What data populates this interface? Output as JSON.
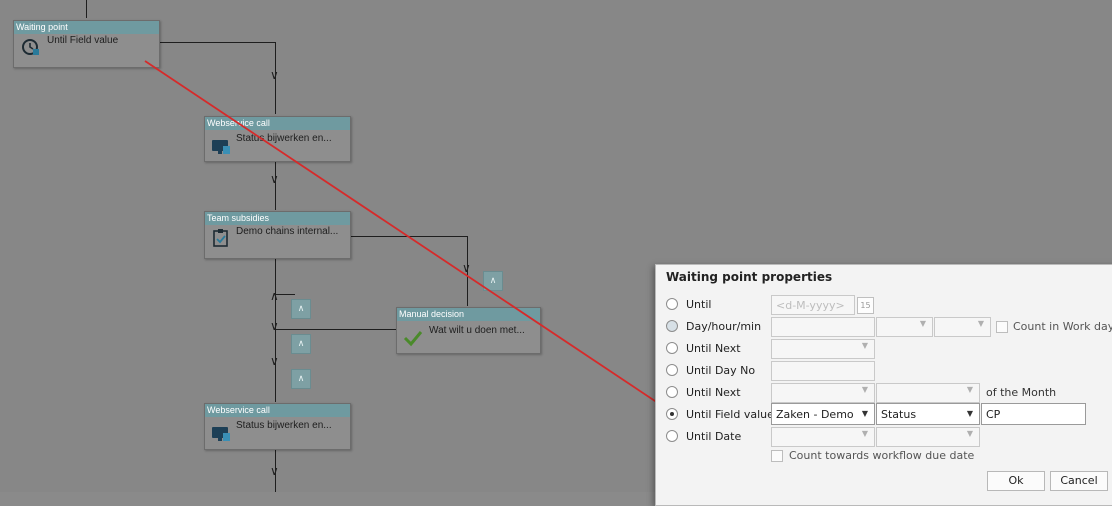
{
  "workflow": {
    "nodes": [
      {
        "title": "Waiting point",
        "text": "Until Field value",
        "icon": "waiting-clock-icon"
      },
      {
        "title": "Webservice call",
        "text": "Status bijwerken en...",
        "icon": "webservice-monitor-icon"
      },
      {
        "title": "Team subsidies",
        "text": "Demo chains internal...",
        "icon": "task-clipboard-icon"
      },
      {
        "title": "Manual decision",
        "text": "Wat wilt u doen met...",
        "icon": "checkmark-icon"
      },
      {
        "title": "Webservice call",
        "text": "Status bijwerken en...",
        "icon": "webservice-monitor-icon"
      }
    ],
    "annotation_color": "#d62a2a"
  },
  "dialog": {
    "title": "Waiting point properties",
    "rows": [
      {
        "label": "Until",
        "checked": false
      },
      {
        "label": "Day/hour/min",
        "checked": false
      },
      {
        "label": "Until Next",
        "checked": false
      },
      {
        "label": "Until Day No",
        "checked": false
      },
      {
        "label": "Until Next",
        "checked": false
      },
      {
        "label": "Until Field value",
        "checked": true
      },
      {
        "label": "Until Date",
        "checked": false
      }
    ],
    "date_placeholder": "<d-M-yyyy>",
    "calendar_day": "15",
    "count_in_work_days": "Count in Work days",
    "of_the_month": "of the Month",
    "field_value": {
      "entity": "Zaken - Demo",
      "field": "Status",
      "value": "CP"
    },
    "count_towards_due_date": "Count towards workflow due date",
    "ok_label": "Ok",
    "cancel_label": "Cancel"
  }
}
